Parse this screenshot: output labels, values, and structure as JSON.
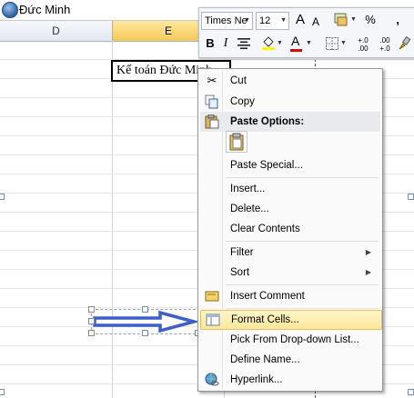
{
  "name_bar": {
    "text": "Đức Minh",
    "icon": "office-orb-icon"
  },
  "columns": [
    {
      "label": "D",
      "selected": false
    },
    {
      "label": "E",
      "selected": true
    }
  ],
  "textbox": {
    "text": "Kế toán Đức Minh"
  },
  "arrow_shape": {
    "color": "#3f5fc8"
  },
  "mini_toolbar": {
    "font_name": "Times Ne",
    "font_size": "12",
    "bold": "B",
    "italic": "I",
    "align_center_icon": "align-center-icon",
    "font_color_label": "A",
    "percent": "%",
    "comma": ",",
    "increase_decimal": "+.0 .00",
    "decrease_decimal": ".00 +.0",
    "grow_font": "A",
    "shrink_font": "A"
  },
  "context_menu": {
    "items": [
      {
        "label": "Cut",
        "icon": "scissors-icon"
      },
      {
        "label": "Copy",
        "icon": "copy-icon"
      },
      {
        "label": "Paste Options:",
        "icon": "paste-icon"
      },
      {
        "label": "Paste Special..."
      },
      {
        "label": "Insert..."
      },
      {
        "label": "Delete..."
      },
      {
        "label": "Clear Contents"
      },
      {
        "label": "Filter",
        "submenu": true
      },
      {
        "label": "Sort",
        "submenu": true
      },
      {
        "label": "Insert Comment",
        "icon": "comment-icon"
      },
      {
        "label": "Format Cells...",
        "icon": "format-cells-icon",
        "highlighted": true
      },
      {
        "label": "Pick From Drop-down List..."
      },
      {
        "label": "Define Name..."
      },
      {
        "label": "Hyperlink...",
        "icon": "hyperlink-icon"
      }
    ]
  },
  "colors": {
    "menu_highlight": "#fde79a",
    "selected_column": "#f6c957",
    "arrow": "#3f5fc8"
  }
}
